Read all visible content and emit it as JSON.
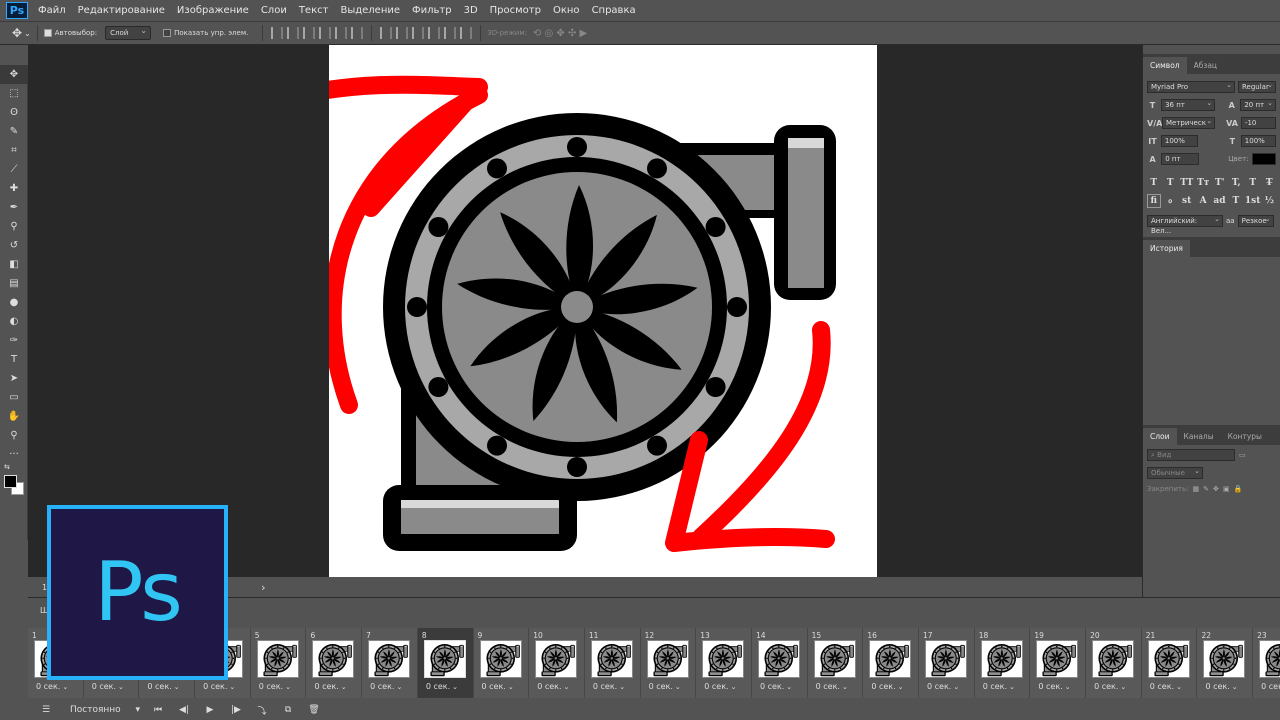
{
  "app": {
    "logo_text": "Ps"
  },
  "menu": [
    "Файл",
    "Редактирование",
    "Изображение",
    "Слои",
    "Текст",
    "Выделение",
    "Фильтр",
    "3D",
    "Просмотр",
    "Окно",
    "Справка"
  ],
  "options_bar": {
    "autoselect_label": "Автовыбор:",
    "autoselect_value": "Слой",
    "show_transform_label": "Показать упр. элем.",
    "mode_3d_label": "3D-режим:"
  },
  "tools": [
    {
      "name": "move-tool",
      "glyph": "✥"
    },
    {
      "name": "marquee-tool",
      "glyph": "⬚"
    },
    {
      "name": "lasso-tool",
      "glyph": "ʘ"
    },
    {
      "name": "quick-select-tool",
      "glyph": "✎"
    },
    {
      "name": "crop-tool",
      "glyph": "⌗"
    },
    {
      "name": "eyedropper-tool",
      "glyph": "⟋"
    },
    {
      "name": "healing-tool",
      "glyph": "✚"
    },
    {
      "name": "brush-tool",
      "glyph": "✒"
    },
    {
      "name": "clone-stamp-tool",
      "glyph": "⚲"
    },
    {
      "name": "history-brush-tool",
      "glyph": "↺"
    },
    {
      "name": "eraser-tool",
      "glyph": "◧"
    },
    {
      "name": "gradient-tool",
      "glyph": "▤"
    },
    {
      "name": "blur-tool",
      "glyph": "●"
    },
    {
      "name": "dodge-tool",
      "glyph": "◐"
    },
    {
      "name": "pen-tool",
      "glyph": "✑"
    },
    {
      "name": "type-tool",
      "glyph": "T"
    },
    {
      "name": "path-select-tool",
      "glyph": "➤"
    },
    {
      "name": "shape-tool",
      "glyph": "▭"
    },
    {
      "name": "hand-tool",
      "glyph": "✋"
    },
    {
      "name": "zoom-tool",
      "glyph": "⚲"
    },
    {
      "name": "more-tools",
      "glyph": "···"
    }
  ],
  "character_panel": {
    "tabs": [
      "Символ",
      "Абзац"
    ],
    "font_family": "Myriad Pro",
    "font_style": "Regular",
    "font_size": "36 пт",
    "leading": "20 пт",
    "kerning": "Метрическ",
    "tracking": "-10",
    "vertical_scale": "100%",
    "horizontal_scale": "100%",
    "baseline_shift": "0 пт",
    "color_label": "Цвет:",
    "language": "Английский: Вел...",
    "antialias_label": "aa",
    "antialias": "Резкое",
    "format_buttons": [
      "T",
      "T",
      "TT",
      "Tт",
      "T'",
      "T,",
      "T",
      "T̶"
    ],
    "opentype_buttons": [
      "fi",
      "ℴ",
      "st",
      "A",
      "ad",
      "T",
      "1st",
      "½"
    ]
  },
  "history_panel": {
    "tab": "История"
  },
  "layers_panel": {
    "tabs": [
      "Слои",
      "Каналы",
      "Контуры"
    ],
    "filter_placeholder": "Вид",
    "blend_mode": "Обычные",
    "lock_label": "Закрепить:"
  },
  "status_bar": {
    "zoom": "1",
    "arrow": "›"
  },
  "timeline": {
    "title": "Ш",
    "loop_option": "Постоянно",
    "selected_frame": 8,
    "frames": [
      {
        "num": "1",
        "delay": "0 сек."
      },
      {
        "num": "2",
        "delay": "0 сек."
      },
      {
        "num": "3",
        "delay": "0 сек."
      },
      {
        "num": "4",
        "delay": "0 сек."
      },
      {
        "num": "5",
        "delay": "0 сек."
      },
      {
        "num": "6",
        "delay": "0 сек."
      },
      {
        "num": "7",
        "delay": "0 сек."
      },
      {
        "num": "8",
        "delay": "0 сек."
      },
      {
        "num": "9",
        "delay": "0 сек."
      },
      {
        "num": "10",
        "delay": "0 сек."
      },
      {
        "num": "11",
        "delay": "0 сек."
      },
      {
        "num": "12",
        "delay": "0 сек."
      },
      {
        "num": "13",
        "delay": "0 сек."
      },
      {
        "num": "14",
        "delay": "0 сек."
      },
      {
        "num": "15",
        "delay": "0 сек."
      },
      {
        "num": "16",
        "delay": "0 сек."
      },
      {
        "num": "17",
        "delay": "0 сек."
      },
      {
        "num": "18",
        "delay": "0 сек."
      },
      {
        "num": "19",
        "delay": "0 сек."
      },
      {
        "num": "20",
        "delay": "0 сек."
      },
      {
        "num": "21",
        "delay": "0 сек."
      },
      {
        "num": "22",
        "delay": "0 сек."
      },
      {
        "num": "23",
        "delay": "0 сек."
      }
    ]
  },
  "overlay_badge": {
    "text": "Ps",
    "bg_color": "#1f1846",
    "border_color": "#27b1f8"
  },
  "colors": {
    "arrow_red": "#ff0000",
    "accent": "#31a8ff"
  }
}
